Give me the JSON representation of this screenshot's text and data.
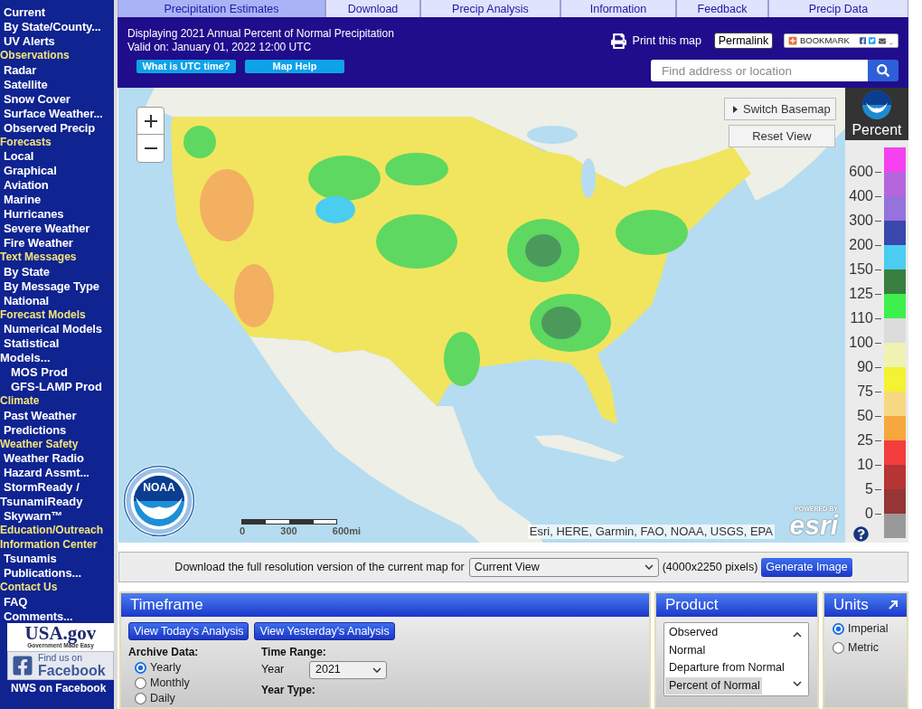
{
  "sidebar": {
    "entries": [
      {
        "kind": "link",
        "label": "Current"
      },
      {
        "kind": "link",
        "label": "By State/County..."
      },
      {
        "kind": "link",
        "label": "UV Alerts"
      },
      {
        "kind": "header",
        "label": "Observations"
      },
      {
        "kind": "link",
        "label": "Radar"
      },
      {
        "kind": "link",
        "label": "Satellite"
      },
      {
        "kind": "link",
        "label": "Snow Cover"
      },
      {
        "kind": "link",
        "label": "Surface Weather..."
      },
      {
        "kind": "link",
        "label": "Observed Precip"
      },
      {
        "kind": "header",
        "label": "Forecasts"
      },
      {
        "kind": "link",
        "label": "Local"
      },
      {
        "kind": "link",
        "label": "Graphical"
      },
      {
        "kind": "link",
        "label": "Aviation"
      },
      {
        "kind": "link",
        "label": "Marine"
      },
      {
        "kind": "link",
        "label": "Hurricanes"
      },
      {
        "kind": "link",
        "label": "Severe Weather"
      },
      {
        "kind": "link",
        "label": "Fire Weather"
      },
      {
        "kind": "header",
        "label": "Text Messages"
      },
      {
        "kind": "link",
        "label": "By State"
      },
      {
        "kind": "link",
        "label": "By Message Type"
      },
      {
        "kind": "link",
        "label": "National"
      },
      {
        "kind": "header",
        "label": "Forecast Models"
      },
      {
        "kind": "link",
        "label": "Numerical Models"
      },
      {
        "kind": "wrapped",
        "label": "Statistical Models..."
      },
      {
        "kind": "sublink",
        "label": "MOS Prod"
      },
      {
        "kind": "sublink",
        "label": "GFS-LAMP Prod"
      },
      {
        "kind": "header",
        "label": "Climate"
      },
      {
        "kind": "link",
        "label": "Past Weather"
      },
      {
        "kind": "link",
        "label": "Predictions"
      },
      {
        "kind": "header",
        "label": "Weather Safety"
      },
      {
        "kind": "link",
        "label": "Weather Radio"
      },
      {
        "kind": "link",
        "label": "Hazard Assmt..."
      },
      {
        "kind": "wrapped",
        "label": "StormReady / TsunamiReady"
      },
      {
        "kind": "link",
        "label": "Skywarn™"
      },
      {
        "kind": "header",
        "label": "Education/Outreach"
      },
      {
        "kind": "header",
        "label": "Information Center"
      },
      {
        "kind": "link",
        "label": "Tsunamis"
      },
      {
        "kind": "link",
        "label": "Publications..."
      },
      {
        "kind": "header",
        "label": "Contact Us"
      },
      {
        "kind": "link",
        "label": "FAQ"
      },
      {
        "kind": "link",
        "label": "Comments..."
      }
    ],
    "usagov": {
      "wordmark": "USA.gov",
      "tagline": "Government Made Easy"
    },
    "facebook_badge": {
      "line1": "Find us on",
      "line2": "Facebook"
    },
    "facebook_link": "NWS on Facebook"
  },
  "tabs": [
    {
      "label": "Precipitation Estimates",
      "selected": true
    },
    {
      "label": "Download",
      "selected": false
    },
    {
      "label": "Precip Analysis",
      "selected": false
    },
    {
      "label": "Information",
      "selected": false
    },
    {
      "label": "Feedback",
      "selected": false
    },
    {
      "label": "Precip Data",
      "selected": false
    }
  ],
  "header": {
    "title": "Displaying 2021 Annual Percent of Normal Precipitation",
    "valid": "Valid on: January 01, 2022 12:00 UTC",
    "buttons": [
      "What is UTC time?",
      "Map Help"
    ],
    "print": "Print this map",
    "permalink": "Permalink",
    "bookmark": "BOOKMARK",
    "search": {
      "placeholder": "Find address or location"
    }
  },
  "map": {
    "basemap_button": "Switch Basemap",
    "reset_button": "Reset View",
    "logo_text": "NOAA",
    "scale": [
      "0",
      "300",
      "600mi"
    ],
    "attribution": "Esri, HERE, Garmin, FAO, NOAA, USGS, EPA",
    "powered_by": "POWERED BY",
    "wordmark": "esri"
  },
  "legend": {
    "title": "Percent",
    "ticks": [
      "600",
      "400",
      "300",
      "200",
      "150",
      "125",
      "110",
      "100",
      "90",
      "75",
      "50",
      "25",
      "10",
      "5",
      "0"
    ],
    "bins": [
      {
        "color": "#f542f0"
      },
      {
        "color": "#b566dc"
      },
      {
        "color": "#9672dc"
      },
      {
        "color": "#3a47ad"
      },
      {
        "color": "#4acdf0"
      },
      {
        "color": "#3a7f42"
      },
      {
        "color": "#3ef04c"
      },
      {
        "color": "#dcdcdc"
      },
      {
        "color": "#f0f2b2"
      },
      {
        "color": "#f4f231"
      },
      {
        "color": "#f7d882"
      },
      {
        "color": "#f6a83c"
      },
      {
        "color": "#f43d3d"
      },
      {
        "color": "#b63434"
      },
      {
        "color": "#953535"
      },
      {
        "color": "#999999"
      }
    ]
  },
  "download": {
    "text": "Download the full resolution version of the current map for",
    "select": "Current View",
    "size": "(4000x2250 pixels)",
    "button": "Generate Image"
  },
  "timeframe": {
    "title": "Timeframe",
    "buttons": [
      "View Today's Analysis",
      "View Yesterday's Analysis"
    ],
    "archive": {
      "label": "Archive Data:",
      "options": [
        {
          "label": "Yearly",
          "selected": true
        },
        {
          "label": "Monthly",
          "selected": false
        },
        {
          "label": "Daily",
          "selected": false
        }
      ]
    },
    "time_range": {
      "label": "Time Range:",
      "field_label": "Year",
      "value": "2021"
    },
    "year_type": {
      "label": "Year Type:"
    }
  },
  "product": {
    "title": "Product",
    "options": [
      {
        "label": "Observed",
        "selected": false
      },
      {
        "label": "Normal",
        "selected": false
      },
      {
        "label": "Departure from Normal",
        "selected": false
      },
      {
        "label": "Percent of Normal",
        "selected": true
      }
    ]
  },
  "units": {
    "title": "Units",
    "options": [
      {
        "label": "Imperial",
        "selected": true
      },
      {
        "label": "Metric",
        "selected": false
      }
    ]
  }
}
